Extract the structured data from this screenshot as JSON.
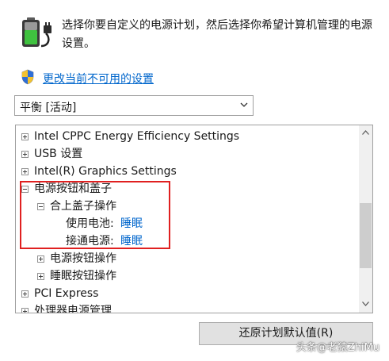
{
  "header": {
    "description": "选择你要自定义的电源计划，然后选择你希望计算机管理的电源设置。",
    "admin_link": "更改当前不可用的设置"
  },
  "plan_select": {
    "value": "平衡 [活动]"
  },
  "tree": {
    "items": [
      {
        "label": "Intel CPPC Energy Efficiency Settings",
        "expanded": false
      },
      {
        "label": "USB 设置",
        "expanded": false
      },
      {
        "label": "Intel(R) Graphics Settings",
        "expanded": false
      },
      {
        "label": "电源按钮和盖子",
        "expanded": true
      },
      {
        "label": "合上盖子操作",
        "expanded": true
      },
      {
        "label": "使用电池:",
        "value": "睡眠"
      },
      {
        "label": "接通电源:",
        "value": "睡眠"
      },
      {
        "label": "电源按钮操作",
        "expanded": false
      },
      {
        "label": "睡眠按钮操作",
        "expanded": false
      },
      {
        "label": "PCI Express",
        "expanded": false
      },
      {
        "label": "处理器电源管理",
        "expanded": false
      }
    ]
  },
  "buttons": {
    "restore": "还原计划默认值(R)"
  },
  "watermark": "头条@老猿ZhiMu",
  "colors": {
    "link": "#0066cc",
    "highlight": "#e02020"
  }
}
